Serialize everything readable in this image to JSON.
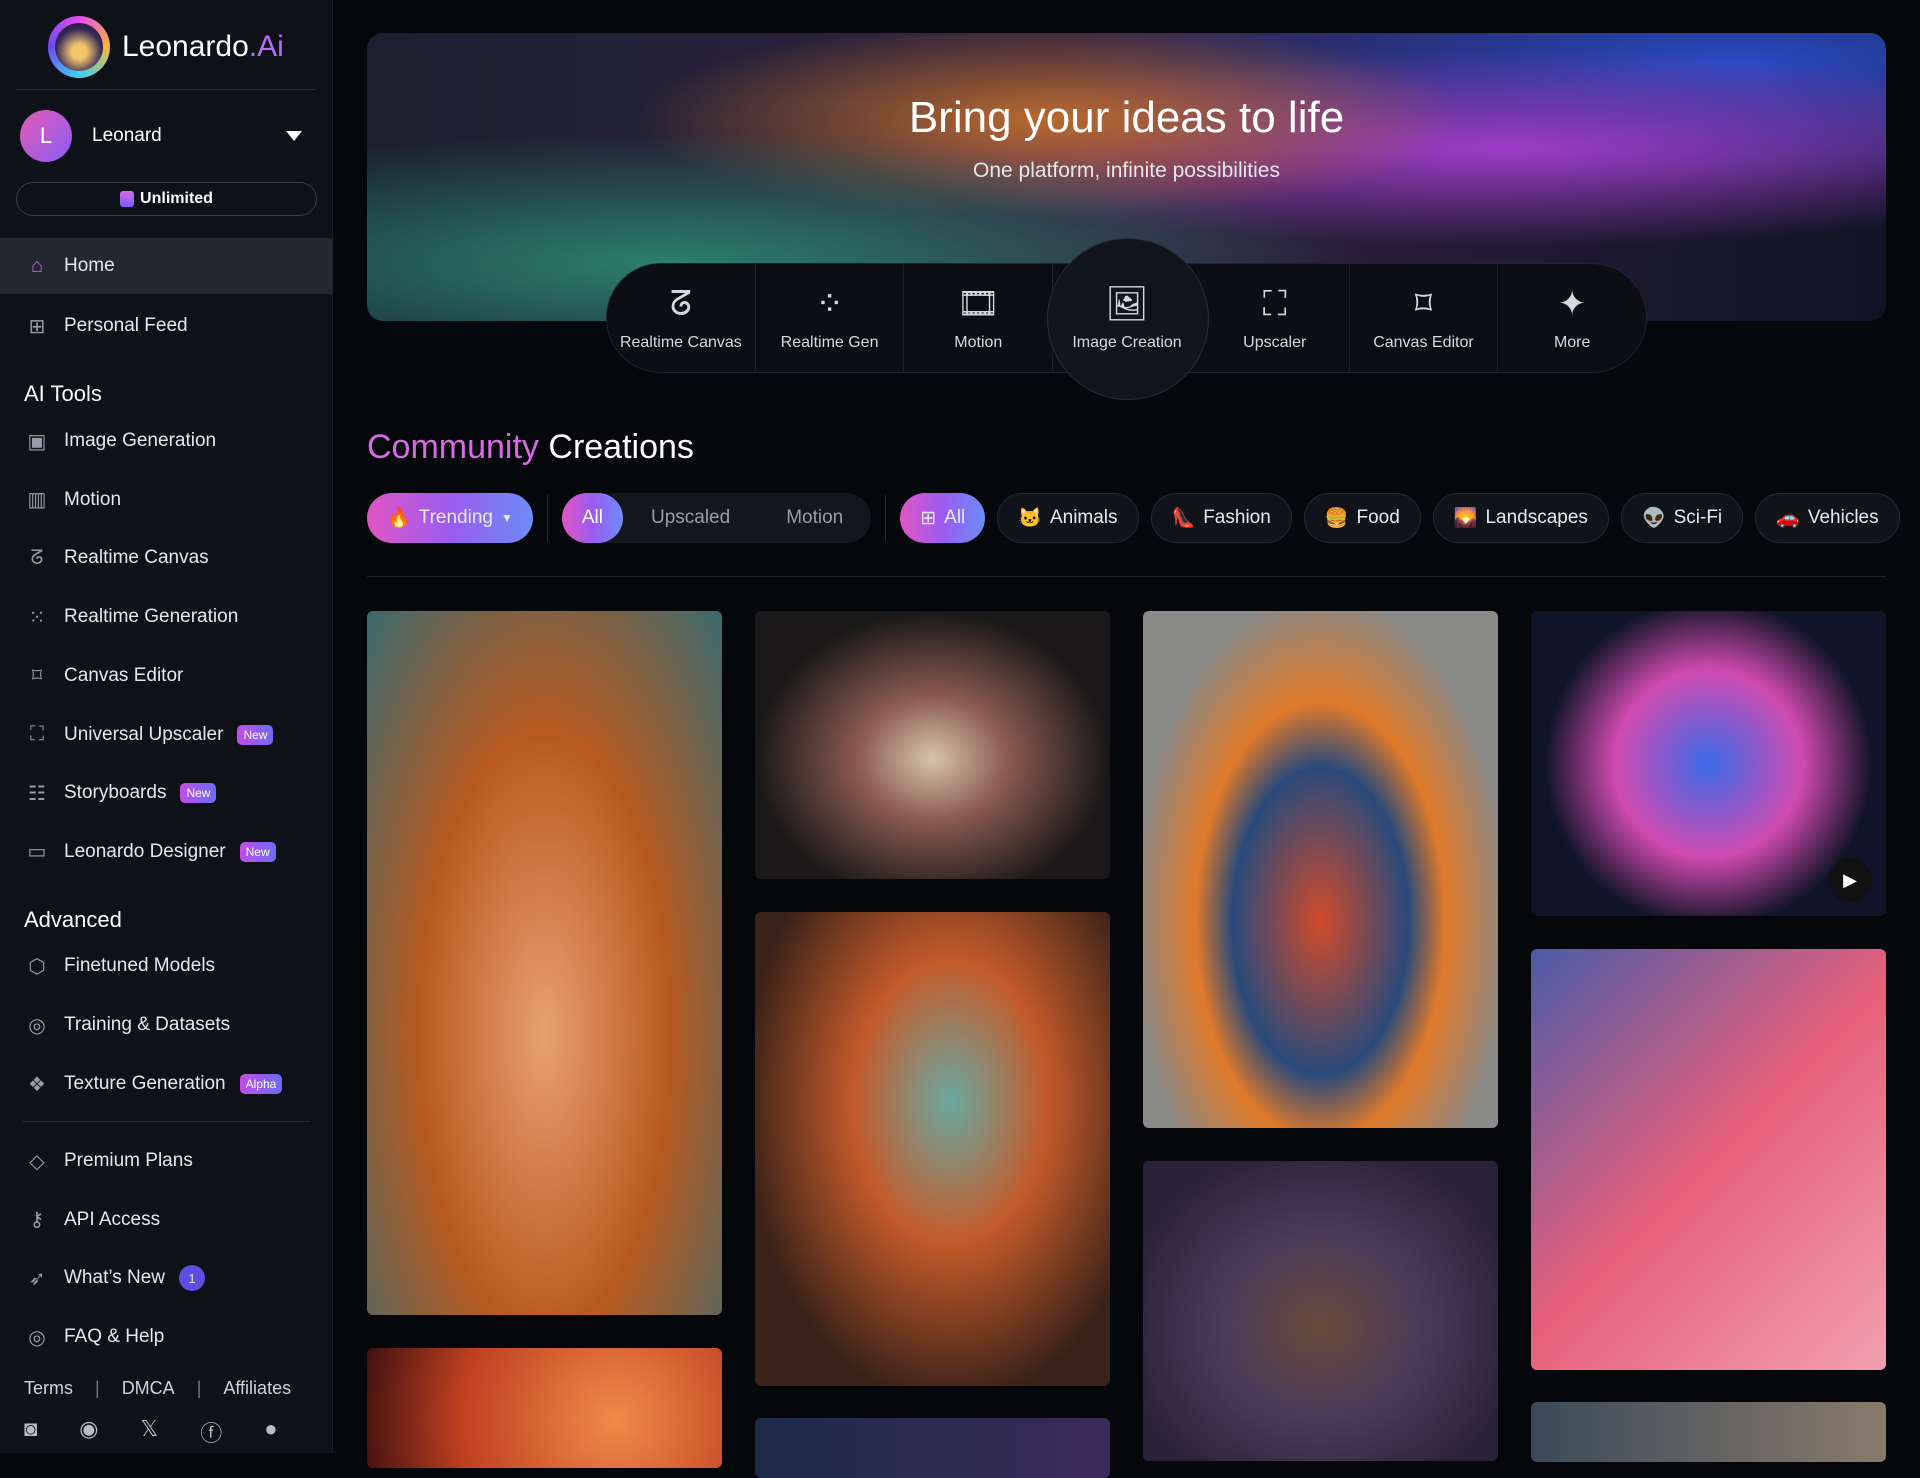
{
  "brand": {
    "name": "Leonardo",
    "suffix": ".Ai"
  },
  "user": {
    "initial": "L",
    "name": "Leonard",
    "plan": "Unlimited"
  },
  "nav": {
    "home": "Home",
    "personal_feed": "Personal Feed"
  },
  "sections": {
    "ai_tools": "AI Tools",
    "advanced": "Advanced"
  },
  "ai_tools": [
    {
      "label": "Image Generation",
      "icon": "image-icon"
    },
    {
      "label": "Motion",
      "icon": "film-icon"
    },
    {
      "label": "Realtime Canvas",
      "icon": "brush-icon"
    },
    {
      "label": "Realtime Generation",
      "icon": "grid-dots-icon"
    },
    {
      "label": "Canvas Editor",
      "icon": "canvas-icon"
    },
    {
      "label": "Universal Upscaler",
      "icon": "upscale-icon",
      "badge": "New"
    },
    {
      "label": "Storyboards",
      "icon": "storyboard-icon",
      "badge": "New"
    },
    {
      "label": "Leonardo Designer",
      "icon": "designer-icon",
      "badge": "New"
    }
  ],
  "advanced": [
    {
      "label": "Finetuned Models",
      "icon": "cube-icon"
    },
    {
      "label": "Training & Datasets",
      "icon": "training-icon"
    },
    {
      "label": "Texture Generation",
      "icon": "texture-icon",
      "badge": "Alpha"
    }
  ],
  "bottom_nav": [
    {
      "label": "Premium Plans",
      "icon": "diamond-icon"
    },
    {
      "label": "API Access",
      "icon": "key-icon"
    },
    {
      "label": "What’s New",
      "icon": "rocket-icon",
      "count": "1"
    },
    {
      "label": "FAQ & Help",
      "icon": "lifebuoy-icon"
    }
  ],
  "footer": {
    "terms": "Terms",
    "dmca": "DMCA",
    "affiliates": "Affiliates",
    "sep": "|"
  },
  "social": [
    "discord-icon",
    "reddit-icon",
    "x-icon",
    "facebook-icon",
    "apple-icon"
  ],
  "hero": {
    "title": "Bring your ideas to life",
    "subtitle": "One platform, infinite possibilities"
  },
  "tools": [
    {
      "label": "Realtime Canvas",
      "glyph": "ᘔ"
    },
    {
      "label": "Realtime Gen",
      "glyph": "⁘"
    },
    {
      "label": "Motion",
      "glyph": "🎞"
    },
    {
      "label": "Image Creation",
      "glyph": "🖼"
    },
    {
      "label": "Upscaler",
      "glyph": "⛶"
    },
    {
      "label": "Canvas Editor",
      "glyph": "⌑"
    },
    {
      "label": "More",
      "glyph": "✦"
    }
  ],
  "community": {
    "highlight": "Community",
    "rest": " Creations"
  },
  "filters": {
    "sort": "Trending",
    "types": [
      "All",
      "Upscaled",
      "Motion"
    ],
    "categories": [
      {
        "label": "All",
        "glyph": "⊞"
      },
      {
        "label": "Animals",
        "glyph": "🐱"
      },
      {
        "label": "Fashion",
        "glyph": "👠"
      },
      {
        "label": "Food",
        "glyph": "🍔"
      },
      {
        "label": "Landscapes",
        "glyph": "🌄"
      },
      {
        "label": "Sci-Fi",
        "glyph": "👽"
      },
      {
        "label": "Vehicles",
        "glyph": "🚗"
      }
    ]
  },
  "colors": {
    "accent": "#d86ae8",
    "bg": "#06070b",
    "sidebar": "#0f1118"
  }
}
